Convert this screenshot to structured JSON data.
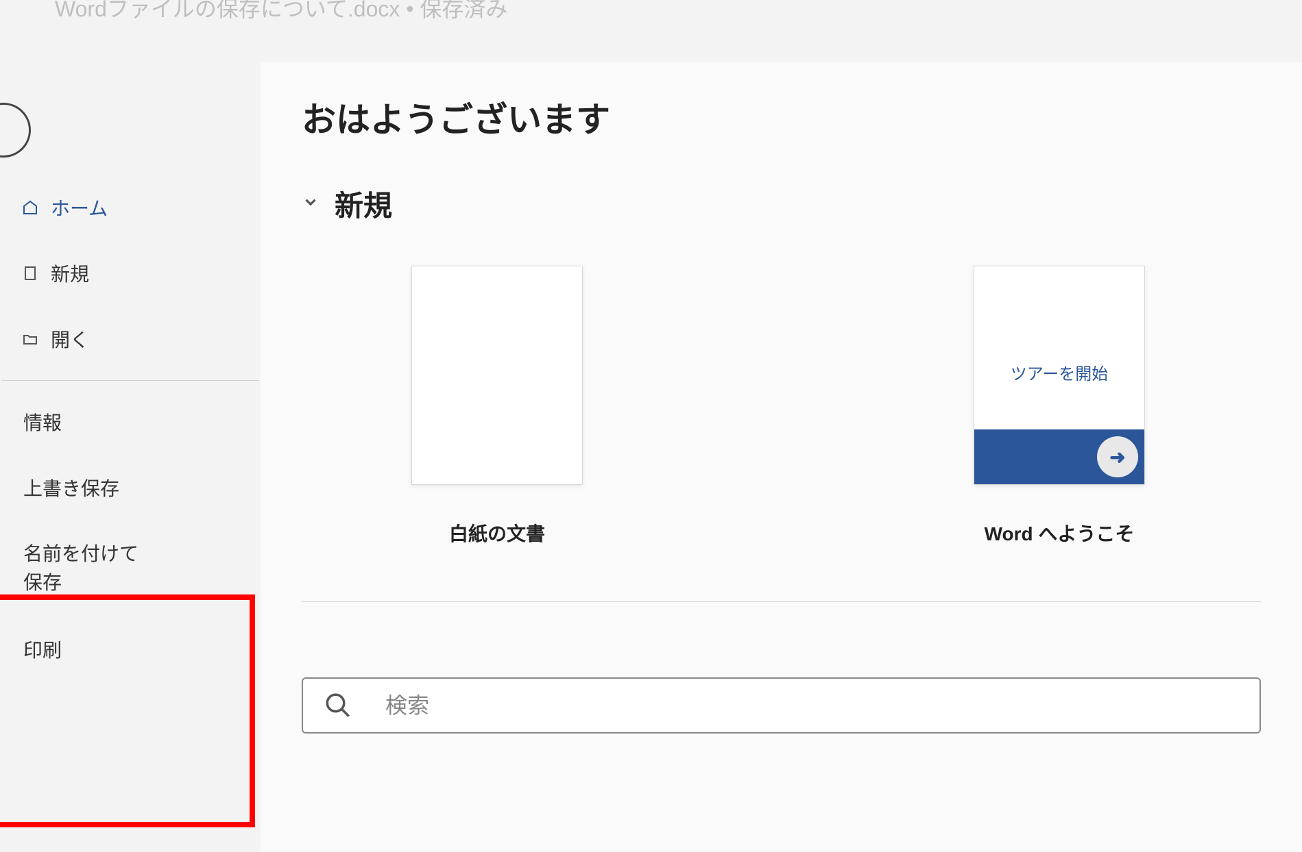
{
  "titlebar": {
    "text": "Wordファイルの保存について.docx • 保存済み"
  },
  "sidebar": {
    "home": "ホーム",
    "new": "新規",
    "open": "開く",
    "info": "情報",
    "save": "上書き保存",
    "save_as": "名前を付けて保存",
    "print": "印刷"
  },
  "main": {
    "greeting": "おはようございます",
    "new_section": "新規",
    "templates": {
      "blank": {
        "label": "白紙の文書"
      },
      "welcome": {
        "thumb_text": "ツアーを開始",
        "label": "Word へようこそ"
      }
    },
    "search_placeholder": "検索"
  }
}
